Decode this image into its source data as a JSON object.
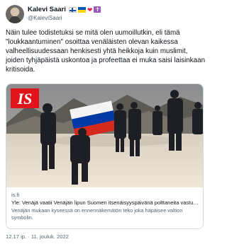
{
  "author": {
    "name": "Kalevi Saari",
    "handle": "@KaleviSaari",
    "badges": [
      "finland-flag-icon",
      "ukraine-flag-icon",
      "heart-icon",
      "latin-cross-icon"
    ],
    "heart_glyph": "❤",
    "cross_glyph": "✝"
  },
  "tweet": {
    "text": "Näin tulee todistetuksi se mitä olen uumoillutkin, eli tämä \"loukkaantuminen\" osoittaa venäläisten olevan kaikessa valheellisuudessaan henkisesti yhtä heikkoja kuin muslimit, joiden tyhjäpäistä uskontoa ja profeettaa ei muka saisi laisinkaan kritisoida.",
    "timestamp": "12.17 ip. · 11. jouluk. 2022"
  },
  "card": {
    "logo_text": "IS",
    "domain": "is.fi",
    "title": "Yle: Venäjä vaatii Venäjän lipun Suomen itsenäisyyspäivänä polttaneita vastuu...",
    "description": "Venäjän mukaan kyseessä on ennennäkemätön teko joka häpäisee valtion symbolin."
  },
  "colors": {
    "is_red": "#e1141b",
    "ukraine_blue": "#0057b7",
    "ukraine_yellow": "#ffd700",
    "flag_red": "#d52b1e",
    "flag_blue": "#0039a6",
    "link_gray": "#536471"
  }
}
